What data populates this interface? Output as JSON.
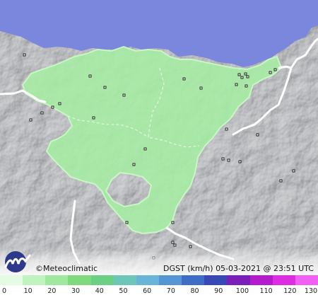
{
  "credit": "©Meteoclimatic",
  "variable": "DGST",
  "unit": "(km/h)",
  "timestamp": "05-03-2021 @ 23:51 UTC",
  "legend": {
    "labels": [
      "0",
      "10",
      "20",
      "30",
      "40",
      "50",
      "60",
      "70",
      "80",
      "90",
      "100",
      "110",
      "120",
      "130"
    ],
    "colors": [
      "#e4fbe4",
      "#bff3bf",
      "#9fe89e",
      "#7fd97f",
      "#6ccf86",
      "#6cc7b9",
      "#69b5d8",
      "#5796d4",
      "#3f6cc4",
      "#3848b4",
      "#7a20b8",
      "#b21ccc",
      "#dc2ee0",
      "#f060f2"
    ]
  },
  "map": {
    "sea_color": "#7b87dd",
    "relief_color": "#8a8d96",
    "gust_zone_color": "#a6eda4",
    "gust_zone_label": "10-20 km/h"
  }
}
